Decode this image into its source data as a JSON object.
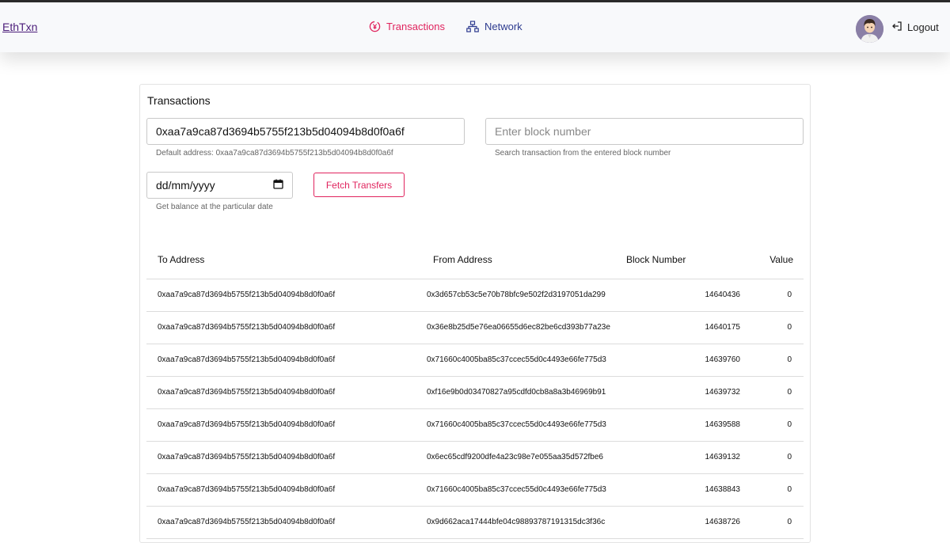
{
  "brand": "EthTxn",
  "nav": {
    "transactions": "Transactions",
    "network": "Network",
    "logout": "Logout"
  },
  "colors": {
    "accent": "#e0245e",
    "nav_secondary": "#2d3b8f",
    "brand": "#4b1d7a"
  },
  "card": {
    "title": "Transactions",
    "address_value": "0xaa7a9ca87d3694b5755f213b5d04094b8d0f0a6f",
    "address_helper": "Default address: 0xaa7a9ca87d3694b5755f213b5d04094b8d0f0a6f",
    "block_placeholder": "Enter block number",
    "block_helper": "Search transaction from the entered block number",
    "date_value": "dd/mm/yyyy",
    "date_helper": "Get balance at the particular date",
    "fetch_label": "Fetch Transfers"
  },
  "table": {
    "headers": {
      "to": "To Address",
      "from": "From Address",
      "block": "Block Number",
      "value": "Value"
    },
    "rows": [
      {
        "to": "0xaa7a9ca87d3694b5755f213b5d04094b8d0f0a6f",
        "from": "0x3d657cb53c5e70b78bfc9e502f2d3197051da299",
        "block": "14640436",
        "value": "0"
      },
      {
        "to": "0xaa7a9ca87d3694b5755f213b5d04094b8d0f0a6f",
        "from": "0x36e8b25d5e76ea06655d6ec82be6cd393b77a23e",
        "block": "14640175",
        "value": "0"
      },
      {
        "to": "0xaa7a9ca87d3694b5755f213b5d04094b8d0f0a6f",
        "from": "0x71660c4005ba85c37ccec55d0c4493e66fe775d3",
        "block": "14639760",
        "value": "0"
      },
      {
        "to": "0xaa7a9ca87d3694b5755f213b5d04094b8d0f0a6f",
        "from": "0xf16e9b0d03470827a95cdfd0cb8a8a3b46969b91",
        "block": "14639732",
        "value": "0"
      },
      {
        "to": "0xaa7a9ca87d3694b5755f213b5d04094b8d0f0a6f",
        "from": "0x71660c4005ba85c37ccec55d0c4493e66fe775d3",
        "block": "14639588",
        "value": "0"
      },
      {
        "to": "0xaa7a9ca87d3694b5755f213b5d04094b8d0f0a6f",
        "from": "0x6ec65cdf9200dfe4a23c98e7e055aa35d572fbe6",
        "block": "14639132",
        "value": "0"
      },
      {
        "to": "0xaa7a9ca87d3694b5755f213b5d04094b8d0f0a6f",
        "from": "0x71660c4005ba85c37ccec55d0c4493e66fe775d3",
        "block": "14638843",
        "value": "0"
      },
      {
        "to": "0xaa7a9ca87d3694b5755f213b5d04094b8d0f0a6f",
        "from": "0x9d662aca17444bfe04c98893787191315dc3f36c",
        "block": "14638726",
        "value": "0"
      }
    ]
  }
}
